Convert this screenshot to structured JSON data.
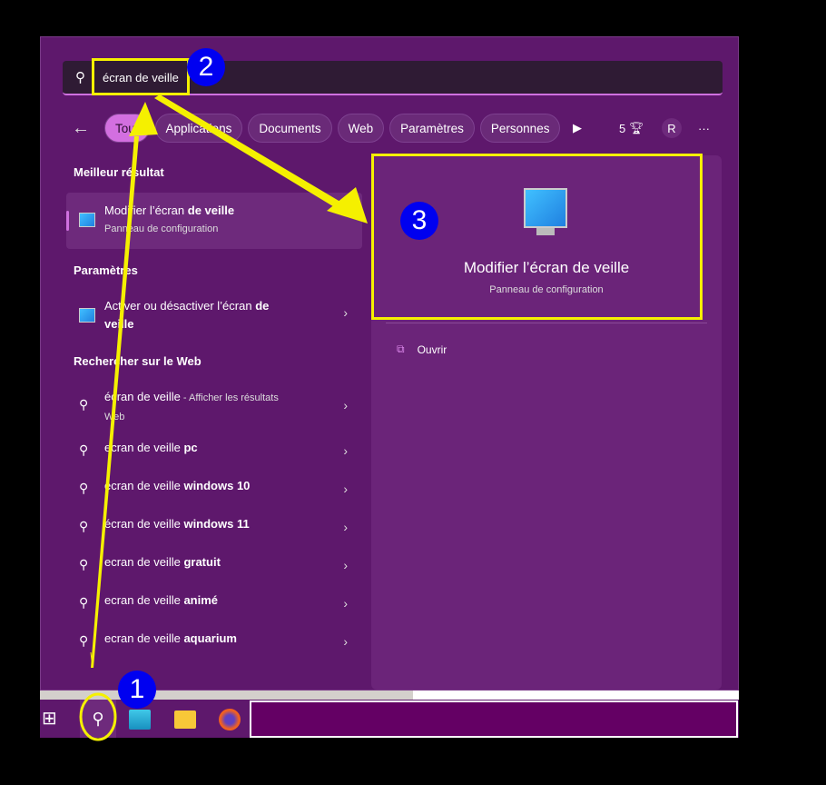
{
  "search": {
    "icon": "search-icon",
    "value": "écran de veille"
  },
  "filters": {
    "items": [
      "Tout",
      "Applications",
      "Documents",
      "Web",
      "Paramètres",
      "Personnes"
    ],
    "active": "Tout",
    "points": "5",
    "avatar": "R",
    "more": "···"
  },
  "sections": {
    "best": "Meilleur résultat",
    "settings": "Paramètres",
    "web": "Rechercher sur le Web"
  },
  "best_result": {
    "title_a": "Modifier l’écran ",
    "title_b": "de veille",
    "subtitle": "Panneau de configuration"
  },
  "settings_result": {
    "title_a": "Activer ou désactiver l’écran ",
    "title_b": "de",
    "title_c": "veille"
  },
  "web_results": [
    {
      "a": "écran de veille",
      "b": "",
      "c": " - Afficher les résultats",
      "d": "Web"
    },
    {
      "a": "ecran de veille ",
      "b": "pc"
    },
    {
      "a": "écran de veille ",
      "b": "windows 10"
    },
    {
      "a": "écran de veille ",
      "b": "windows 11"
    },
    {
      "a": "ecran de veille ",
      "b": "gratuit"
    },
    {
      "a": "ecran de veille ",
      "b": "animé"
    },
    {
      "a": "ecran de veille ",
      "b": "aquarium"
    }
  ],
  "detail": {
    "title": "Modifier l’écran de veille",
    "subtitle": "Panneau de configuration",
    "open": "Ouvrir"
  },
  "annotations": [
    "1",
    "2",
    "3"
  ],
  "colors": {
    "panel": "#5e186c",
    "accent": "#d36fe0",
    "highlight": "#f5f000",
    "badge": "#0000f0"
  }
}
